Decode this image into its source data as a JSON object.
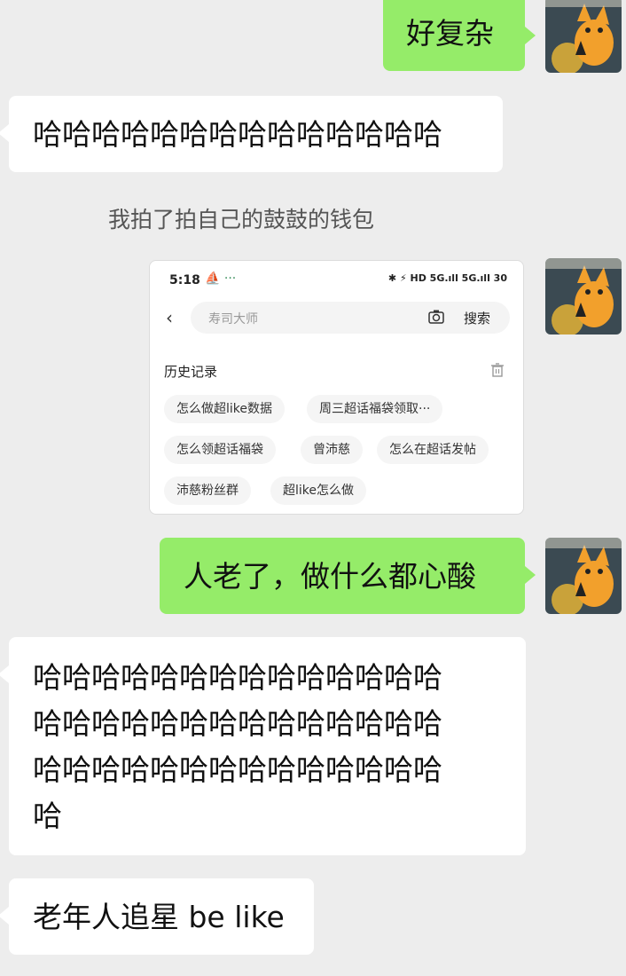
{
  "messages": {
    "m1": "好复杂",
    "m2": "哈哈哈哈哈哈哈哈哈哈哈哈哈哈",
    "caption": "我拍了拍自己的鼓鼓的钱包",
    "m4": "人老了，做什么都心酸",
    "m5_lines": [
      "哈哈哈哈哈哈哈哈哈哈哈哈哈哈",
      "哈哈哈哈哈哈哈哈哈哈哈哈哈哈",
      "哈哈哈哈哈哈哈哈哈哈哈哈哈哈",
      "哈"
    ],
    "m6": "老年人追星 be like"
  },
  "screenshot": {
    "status_time": "5:18",
    "status_extra": "⛵ ···",
    "status_right": "✱ ⚡ HD 5G.ıll 5G.ıll 30",
    "search_placeholder": "寿司大师",
    "search_button": "搜索",
    "history_title": "历史记录",
    "chips": [
      "怎么做超like数据",
      "周三超话福袋领取···",
      "怎么领超话福袋",
      "曾沛慈",
      "怎么在超话发帖",
      "沛慈粉丝群",
      "超like怎么做"
    ]
  },
  "colors": {
    "incoming": "#ffffff",
    "outgoing": "#95ec69",
    "background": "#ededed"
  }
}
